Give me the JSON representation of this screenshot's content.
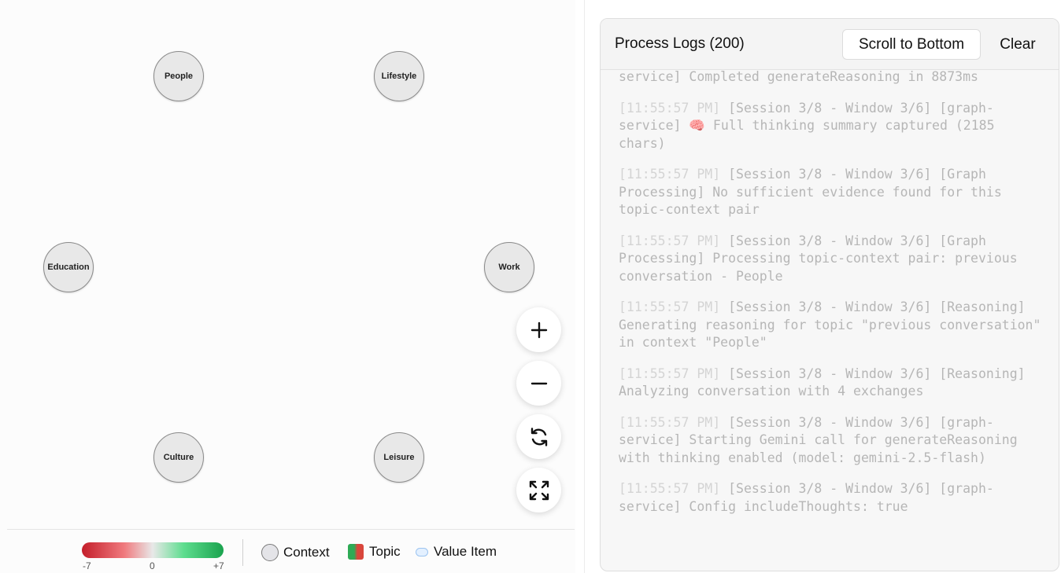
{
  "graph": {
    "nodes": [
      {
        "id": "people",
        "label": "People"
      },
      {
        "id": "lifestyle",
        "label": "Lifestyle"
      },
      {
        "id": "education",
        "label": "Education"
      },
      {
        "id": "work",
        "label": "Work"
      },
      {
        "id": "culture",
        "label": "Culture"
      },
      {
        "id": "leisure",
        "label": "Leisure"
      }
    ],
    "controls": {
      "zoom_in_icon": "plus-icon",
      "zoom_out_icon": "minus-icon",
      "reset_icon": "refresh-icon",
      "fullscreen_icon": "expand-icon"
    }
  },
  "legend": {
    "gradient": {
      "min": "-7",
      "mid": "0",
      "max": "+7",
      "colors": [
        "#c41e2a",
        "#e8e8e8",
        "#1aa34e"
      ]
    },
    "context_label": "Context",
    "topic_label": "Topic",
    "value_item_label": "Value Item"
  },
  "logs": {
    "title": "Process Logs (200)",
    "scroll_button": "Scroll to Bottom",
    "clear_button": "Clear",
    "first_line": "service] Completed generateReasoning in 8873ms",
    "entries": [
      {
        "time": "[11:55:57 PM]",
        "prefix": " [Session 3/8 - Window 3/6] [graph-service] ",
        "icon": "🧠",
        "text": " Full thinking summary captured (2185 chars)"
      },
      {
        "time": "[11:55:57 PM]",
        "text": " [Session 3/8 - Window 3/6] [Graph Processing] No sufficient evidence found for this topic-context pair"
      },
      {
        "time": "[11:55:57 PM]",
        "text": " [Session 3/8 - Window 3/6] [Graph Processing] Processing topic-context pair: previous conversation - People"
      },
      {
        "time": "[11:55:57 PM]",
        "text": " [Session 3/8 - Window 3/6] [Reasoning] Generating reasoning for topic \"previous conversation\" in context \"People\""
      },
      {
        "time": "[11:55:57 PM]",
        "text": " [Session 3/8 - Window 3/6] [Reasoning] Analyzing conversation with 4 exchanges"
      },
      {
        "time": "[11:55:57 PM]",
        "text": " [Session 3/8 - Window 3/6] [graph-service] Starting Gemini call for generateReasoning with thinking enabled (model: gemini-2.5-flash)"
      },
      {
        "time": "[11:55:57 PM]",
        "text": " [Session 3/8 - Window 3/6] [graph-service] Config includeThoughts: true"
      }
    ]
  }
}
